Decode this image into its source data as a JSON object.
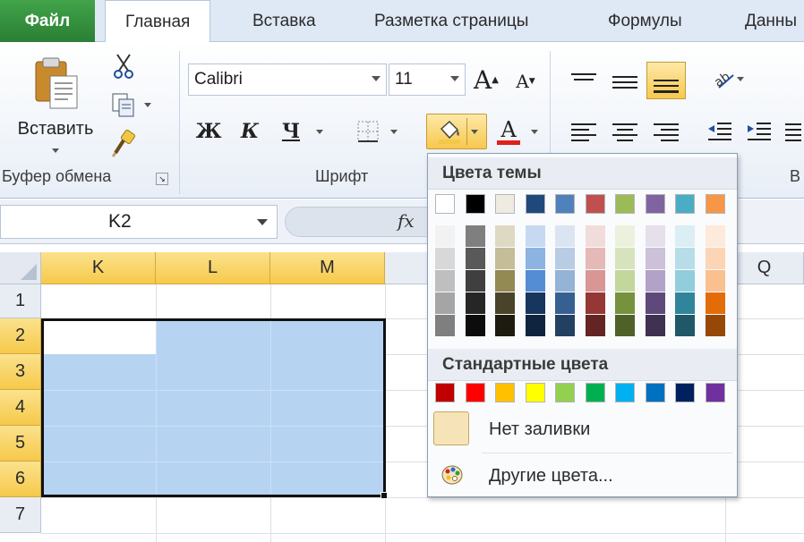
{
  "tabs": {
    "file": "Файл",
    "items": [
      "Главная",
      "Вставка",
      "Разметка страницы",
      "Формулы",
      "Данны"
    ]
  },
  "ribbon": {
    "clipboard": {
      "paste_label": "Вставить",
      "group_label": "Буфер обмена"
    },
    "font": {
      "font_name": "Calibri",
      "font_size": "11",
      "bold": "Ж",
      "italic": "К",
      "underline": "Ч",
      "grow": "A",
      "shrink": "A",
      "font_color_letter": "A",
      "group_label": "Шрифт"
    },
    "alignment": {
      "group_label_partial": "В"
    }
  },
  "formula_bar": {
    "name_box": "K2",
    "fx": "fx"
  },
  "sheet": {
    "columns": [
      "K",
      "L",
      "M",
      "",
      "Q"
    ],
    "rows": [
      "1",
      "2",
      "3",
      "4",
      "5",
      "6",
      "7"
    ],
    "selected_range": "K2:M6"
  },
  "color_menu": {
    "theme_header": "Цвета темы",
    "standard_header": "Стандартные цвета",
    "no_fill": "Нет заливки",
    "more_colors": "Другие цвета...",
    "theme_colors": [
      "#ffffff",
      "#000000",
      "#eeece1",
      "#1f497d",
      "#4f81bd",
      "#c0504d",
      "#9bbb59",
      "#8064a2",
      "#4bacc6",
      "#f79646"
    ],
    "theme_shades": [
      [
        "#f2f2f2",
        "#d8d8d8",
        "#bfbfbf",
        "#a5a5a5",
        "#7f7f7f"
      ],
      [
        "#7f7f7f",
        "#595959",
        "#3f3f3f",
        "#262626",
        "#0c0c0c"
      ],
      [
        "#ddd9c3",
        "#c4bd97",
        "#938953",
        "#494429",
        "#1d1b10"
      ],
      [
        "#c6d9f0",
        "#8db3e2",
        "#548dd4",
        "#17365d",
        "#0f243e"
      ],
      [
        "#dbe5f1",
        "#b8cce4",
        "#95b3d7",
        "#366092",
        "#244061"
      ],
      [
        "#f2dcdb",
        "#e5b9b7",
        "#d99694",
        "#953734",
        "#632423"
      ],
      [
        "#ebf1dd",
        "#d7e3bc",
        "#c3d69b",
        "#76923c",
        "#4f6128"
      ],
      [
        "#e5e0ec",
        "#ccc1d9",
        "#b2a2c7",
        "#5f497a",
        "#3f3151"
      ],
      [
        "#dbeef3",
        "#b7dde8",
        "#92cddc",
        "#31859b",
        "#205867"
      ],
      [
        "#fdeada",
        "#fbd5b5",
        "#fac08f",
        "#e36c09",
        "#974806"
      ]
    ],
    "standard_colors": [
      "#c00000",
      "#ff0000",
      "#ffc000",
      "#ffff00",
      "#92d050",
      "#00b050",
      "#00b0f0",
      "#0070c0",
      "#002060",
      "#7030a0"
    ]
  }
}
